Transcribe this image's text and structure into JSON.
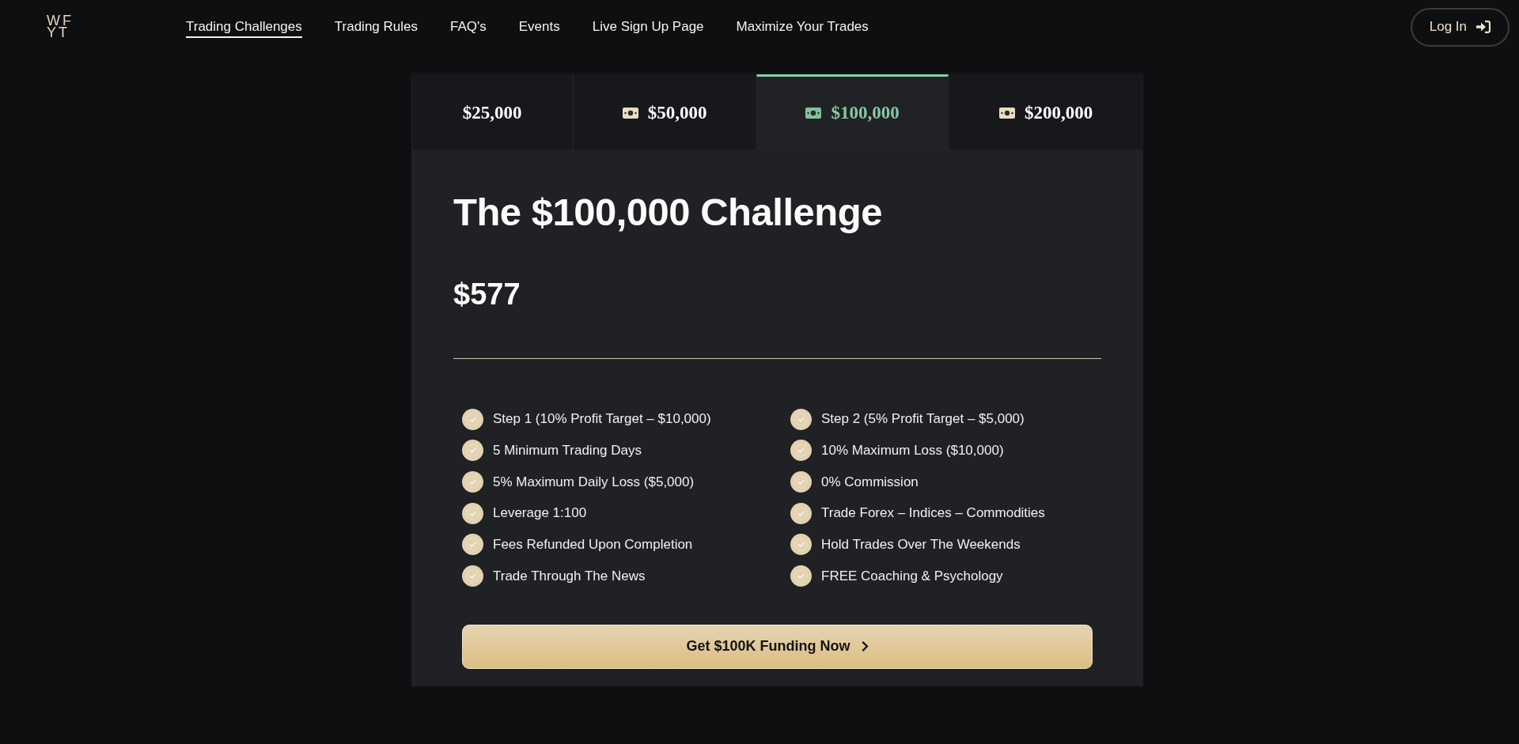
{
  "header": {
    "logo": [
      "WF",
      "YT"
    ],
    "nav": [
      {
        "label": "Trading Challenges",
        "selected": true
      },
      {
        "label": "Trading Rules",
        "selected": false
      },
      {
        "label": "FAQ's",
        "selected": false
      },
      {
        "label": "Events",
        "selected": false
      },
      {
        "label": "Live Sign Up Page",
        "selected": false
      },
      {
        "label": "Maximize Your Trades",
        "selected": false
      }
    ],
    "login_button": {
      "label": "Log In"
    }
  },
  "plan_tabs": [
    {
      "label": "$25,000",
      "kind": "plain",
      "selected": false
    },
    {
      "label": "$50,000",
      "kind": "bill",
      "selected": false
    },
    {
      "label": "$100,000",
      "kind": "bill",
      "selected": true
    },
    {
      "label": "$200,000",
      "kind": "bill",
      "selected": false
    }
  ],
  "plan": {
    "title": "The $100,000 Challenge",
    "price": "$577",
    "features": [
      "Step 1 (10% Profit Target – $10,000)",
      "Step 2 (5% Profit Target – $5,000)",
      "5 Minimum Trading Days",
      "10% Maximum Loss ($10,000)",
      "5% Maximum Daily Loss ($5,000)",
      "0% Commission",
      "Leverage 1:100",
      "Trade Forex – Indices – Commodities",
      "Fees Refunded Upon Completion",
      "Hold Trades Over The Weekends",
      "Trade Through The News",
      "FREE Coaching & Psychology"
    ],
    "cta": {
      "label": "Get $100K Funding Now"
    }
  }
}
